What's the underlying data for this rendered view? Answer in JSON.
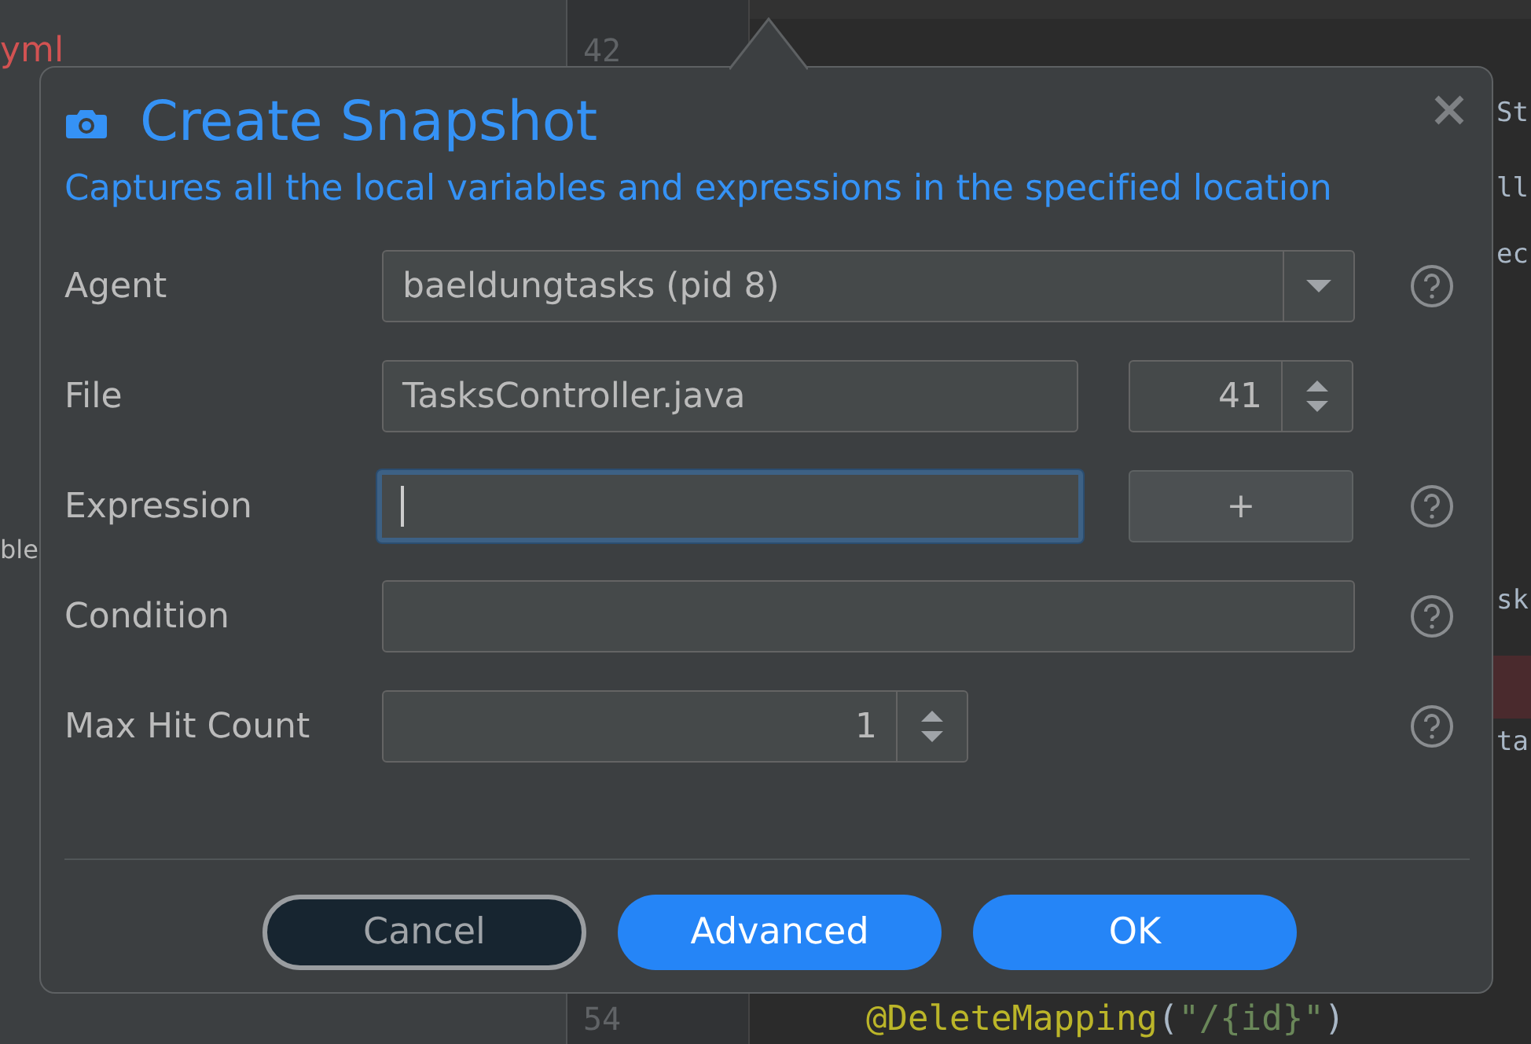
{
  "ide": {
    "sidebar": [
      {
        "text": "yml",
        "kind": "error"
      },
      {
        "text": "ble",
        "kind": "plain"
      }
    ],
    "line_numbers": [
      "42",
      "54"
    ],
    "code_fragments": [
      "St",
      "ll",
      "ec",
      "sk",
      "ta"
    ],
    "code_line": {
      "annotation": "@DeleteMapping",
      "open": "(",
      "string": "\"/{id}\"",
      "close": ")"
    }
  },
  "dialog": {
    "title": "Create Snapshot",
    "subtitle": "Captures all the local variables and expressions in the specified location",
    "rows": [
      {
        "kind": "combo",
        "label": "Agent",
        "value": "baeldungtasks (pid 8)",
        "help": true
      },
      {
        "kind": "file",
        "label": "File",
        "value": "TasksController.java",
        "line": "41",
        "help": false
      },
      {
        "kind": "expression",
        "label": "Expression",
        "value": "",
        "focused": true,
        "add": "+",
        "help": true
      },
      {
        "kind": "text",
        "label": "Condition",
        "value": "",
        "focused": false,
        "help": true
      },
      {
        "kind": "spinner",
        "label": "Max Hit Count",
        "value": "1",
        "help": true
      }
    ],
    "buttons": [
      {
        "label": "Cancel",
        "kind": "secondary"
      },
      {
        "label": "Advanced",
        "kind": "primary"
      },
      {
        "label": "OK",
        "kind": "primary"
      }
    ]
  }
}
